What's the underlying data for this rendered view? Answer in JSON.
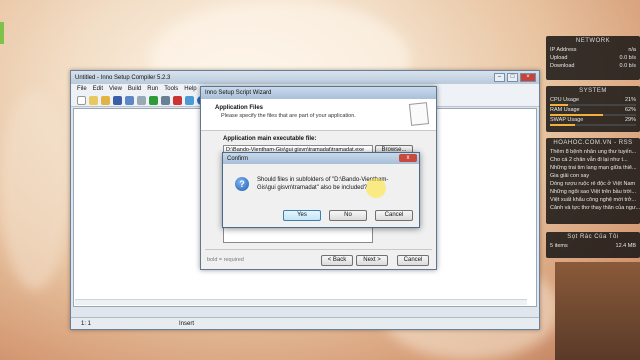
{
  "main_window": {
    "title": "Untitled - Inno Setup Compiler 5.2.3",
    "menu": [
      "File",
      "Edit",
      "View",
      "Build",
      "Run",
      "Tools",
      "Help"
    ],
    "status_position": "1:  1",
    "status_mode": "Insert"
  },
  "wizard": {
    "title": "Inno Setup Script Wizard",
    "heading": "Application Files",
    "subheading": "Please specify the files that are part of your application.",
    "field_label": "Application main executable file:",
    "field_value": "D:\\Bando-Vientham-Gis\\gui gisvn\\tramadat\\tramadat.exe",
    "browse_label": "Browse...",
    "footer_note": "bold = required",
    "back_label": "< Back",
    "next_label": "Next >",
    "cancel_label": "Cancel"
  },
  "confirm": {
    "title": "Confirm",
    "close_label": "x",
    "message": "Should files in subfolders of \"D:\\Bando-Vientham-Gis\\gui gisvn\\tramadat\" also be included?",
    "yes_label": "Yes",
    "no_label": "No",
    "cancel_label": "Cancel"
  },
  "network_gadget": {
    "header": "NETWORK",
    "rows": [
      {
        "label": "IP Address",
        "value": "n/a"
      },
      {
        "label": "Upload",
        "value": "0.0 b/s"
      },
      {
        "label": "Download",
        "value": "0.0 b/s"
      }
    ]
  },
  "system_gadget": {
    "header": "SYSTEM",
    "rows": [
      {
        "label": "CPU Usage",
        "value": "21%",
        "level": 0.21
      },
      {
        "label": "RAM Usage",
        "value": "62%",
        "level": 0.62
      },
      {
        "label": "SWAP Usage",
        "value": "29%",
        "level": 0.29
      }
    ]
  },
  "rss_gadget": {
    "header": "HOAHOC.COM.VN - RSS",
    "items": [
      "Thêm 8 bệnh nhân ung thư tuyến...",
      "Cho cá 2 chân vẫn đi lại như t...",
      "Những trai tim lang mạn giữa thiê...",
      "Gia giải con say",
      "Dòng rượu ruộc rẻ độc ở Việt Nam",
      "Những ngôi sao Việt trên bầu trời...",
      "Việt xuất khẩu công nghệ mới trở...",
      "Cảnh và tực thơ thay thân của ngư..."
    ]
  },
  "recycle_gadget": {
    "header": "Sọt Rác Của Tôi",
    "items_label": "5 items",
    "size": "12.4 MB"
  }
}
